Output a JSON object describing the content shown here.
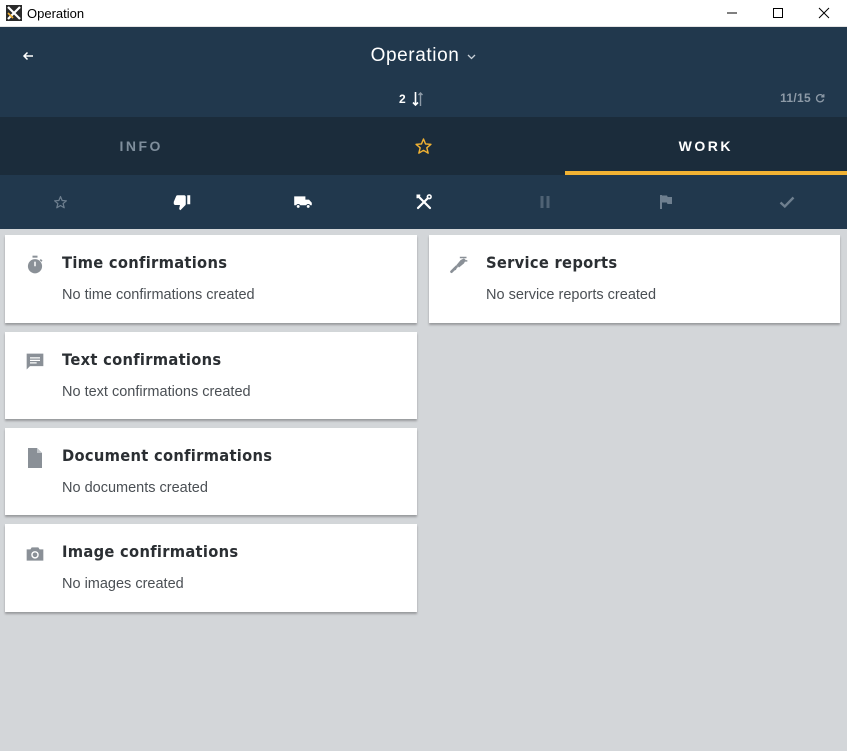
{
  "window": {
    "title": "Operation"
  },
  "header": {
    "title": "Operation",
    "count": "2",
    "page": "11/15"
  },
  "tabs": [
    {
      "label": "INFO",
      "active": false
    },
    {
      "label": "",
      "icon": "star-icon",
      "active": false
    },
    {
      "label": "WORK",
      "active": true
    }
  ],
  "status_icons": [
    "star-outline-icon",
    "thumbs-down-icon",
    "truck-icon",
    "tools-icon",
    "pause-icon",
    "flag-icon",
    "check-icon"
  ],
  "cards": {
    "time": {
      "title": "Time confirmations",
      "subtitle": "No time confirmations created",
      "icon": "stopwatch-icon"
    },
    "text": {
      "title": "Text confirmations",
      "subtitle": "No text confirmations created",
      "icon": "message-icon"
    },
    "document": {
      "title": "Document confirmations",
      "subtitle": "No documents created",
      "icon": "document-icon"
    },
    "image": {
      "title": "Image confirmations",
      "subtitle": "No images created",
      "icon": "camera-icon"
    },
    "service": {
      "title": "Service reports",
      "subtitle": "No service reports created",
      "icon": "service-report-icon"
    }
  },
  "colors": {
    "header": "#21384d",
    "tabs": "#1b2c3b",
    "accent": "#f1b233",
    "background": "#d3d6d9"
  }
}
